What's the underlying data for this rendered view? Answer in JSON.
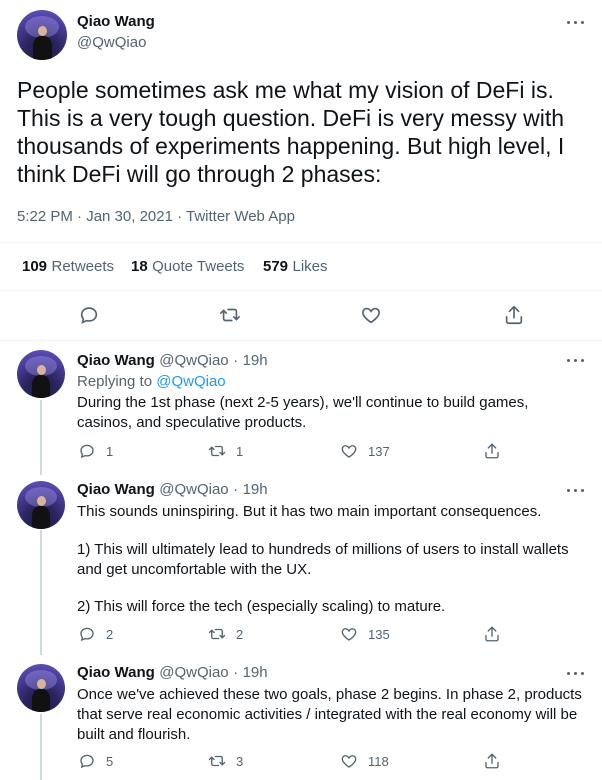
{
  "main_tweet": {
    "author": {
      "name": "Qiao Wang",
      "handle": "@QwQiao"
    },
    "text": "People sometimes ask me what my vision of DeFi is. This is a very tough question. DeFi is very messy with thousands of experiments happening. But high level, I think DeFi will go through 2 phases:",
    "timestamp": "5:22 PM · Jan 30, 2021 · Twitter Web App",
    "stats": {
      "retweets": "109",
      "retweets_label": "Retweets",
      "quotes": "18",
      "quotes_label": "Quote Tweets",
      "likes": "579",
      "likes_label": "Likes"
    },
    "actions": [
      "reply-icon",
      "retweet-icon",
      "like-icon",
      "share-icon"
    ]
  },
  "replies": [
    {
      "name": "Qiao Wang",
      "handle": "@QwQiao",
      "dot": "·",
      "time": "19h",
      "replying_prefix": "Replying to",
      "replying_to": "@QwQiao",
      "text": "During the 1st phase (next 2-5 years), we'll continue to build games, casinos, and speculative products.",
      "reply_count": "1",
      "retweet_count": "1",
      "like_count": "137"
    },
    {
      "name": "Qiao Wang",
      "handle": "@QwQiao",
      "dot": "·",
      "time": "19h",
      "text_p1": "This sounds uninspiring. But it has two main important consequences.",
      "text_p2": "1) This will ultimately lead to hundreds of millions of users to install wallets and get uncomfortable with the UX.",
      "text_p3": "2) This will force the tech (especially scaling) to mature.",
      "reply_count": "2",
      "retweet_count": "2",
      "like_count": "135"
    },
    {
      "name": "Qiao Wang",
      "handle": "@QwQiao",
      "dot": "·",
      "time": "19h",
      "text": "Once we've achieved these two goals, phase 2 begins. In phase 2, products that serve real economic activities / integrated with the real economy will be built and flourish.",
      "reply_count": "5",
      "retweet_count": "3",
      "like_count": "118"
    }
  ]
}
